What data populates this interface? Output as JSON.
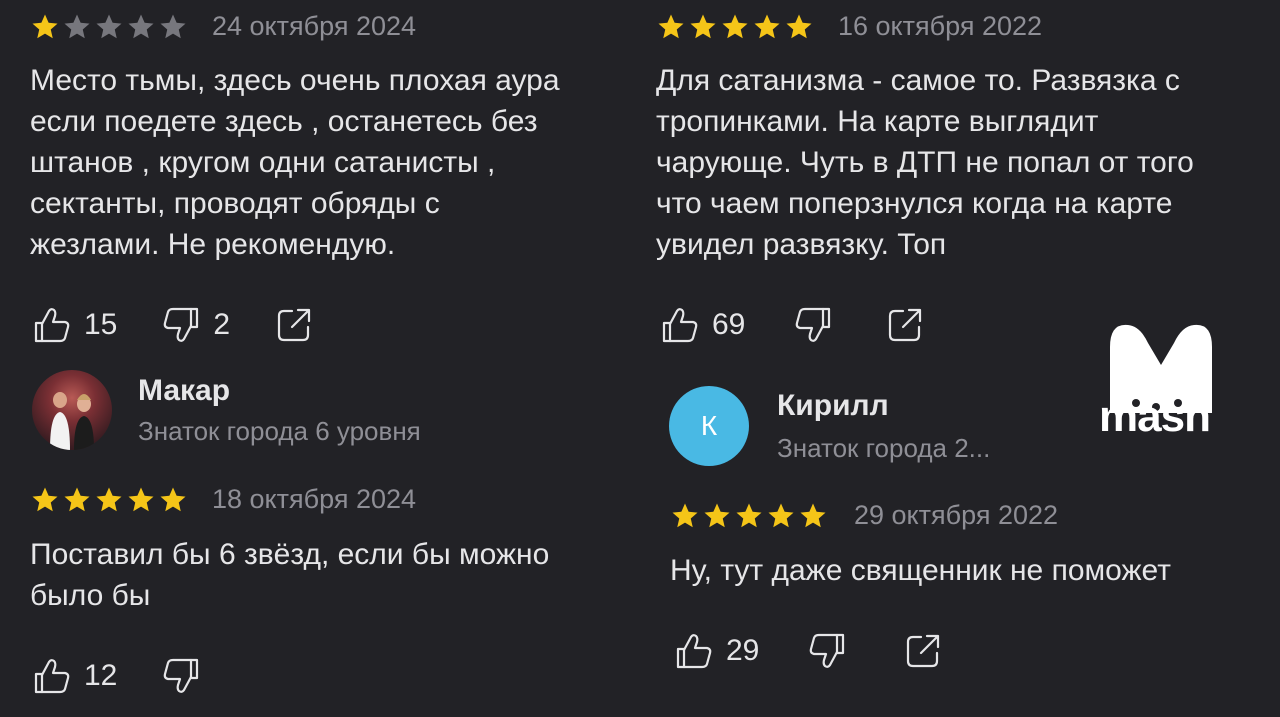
{
  "colors": {
    "background": "#222226",
    "star_on": "#f5c518",
    "star_off": "#77777d",
    "text": "#e6e6e8",
    "muted": "#8f8f96",
    "avatar_blue": "#49b9e4"
  },
  "left": {
    "review1": {
      "rating": 1,
      "date": "24 октября 2024",
      "text": "Место тьмы, здесь очень плохая аура\nесли поедете здесь , останетесь без\nштанов , кругом одни сатанисты ,\nсектанты, проводят обряды с\nжезлами. Не рекомендую.",
      "likes": "15",
      "dislikes": "2"
    },
    "user2": {
      "name": "Макар",
      "level": "Знаток города 6 уровня",
      "avatar": "user-photo"
    },
    "review2": {
      "rating": 5,
      "date": "18 октября 2024",
      "text": "Поставил бы 6 звёзд, если бы можно\nбыло бы",
      "likes": "12"
    }
  },
  "right": {
    "review1": {
      "rating": 5,
      "date": "16 октября 2022",
      "text": "Для сатанизма - самое то. Развязка с\nтропинками. На карте выглядит\nчарующе. Чуть в ДТП не попал от того\nчто чаем поперзнулся когда на карте\nувидел развязку. Топ",
      "likes": "69"
    },
    "user2": {
      "name": "Кирилл",
      "level": "Знаток города 2...",
      "avatar_letter": "К"
    },
    "review2": {
      "rating": 5,
      "date": "29 октября 2022",
      "text": "Ну, тут даже священник не поможет",
      "likes": "29"
    }
  },
  "watermark": {
    "brand": "mash"
  },
  "icons": {
    "like": "thumbs-up-icon",
    "dislike": "thumbs-down-icon",
    "share": "share-icon",
    "star": "star-icon"
  }
}
